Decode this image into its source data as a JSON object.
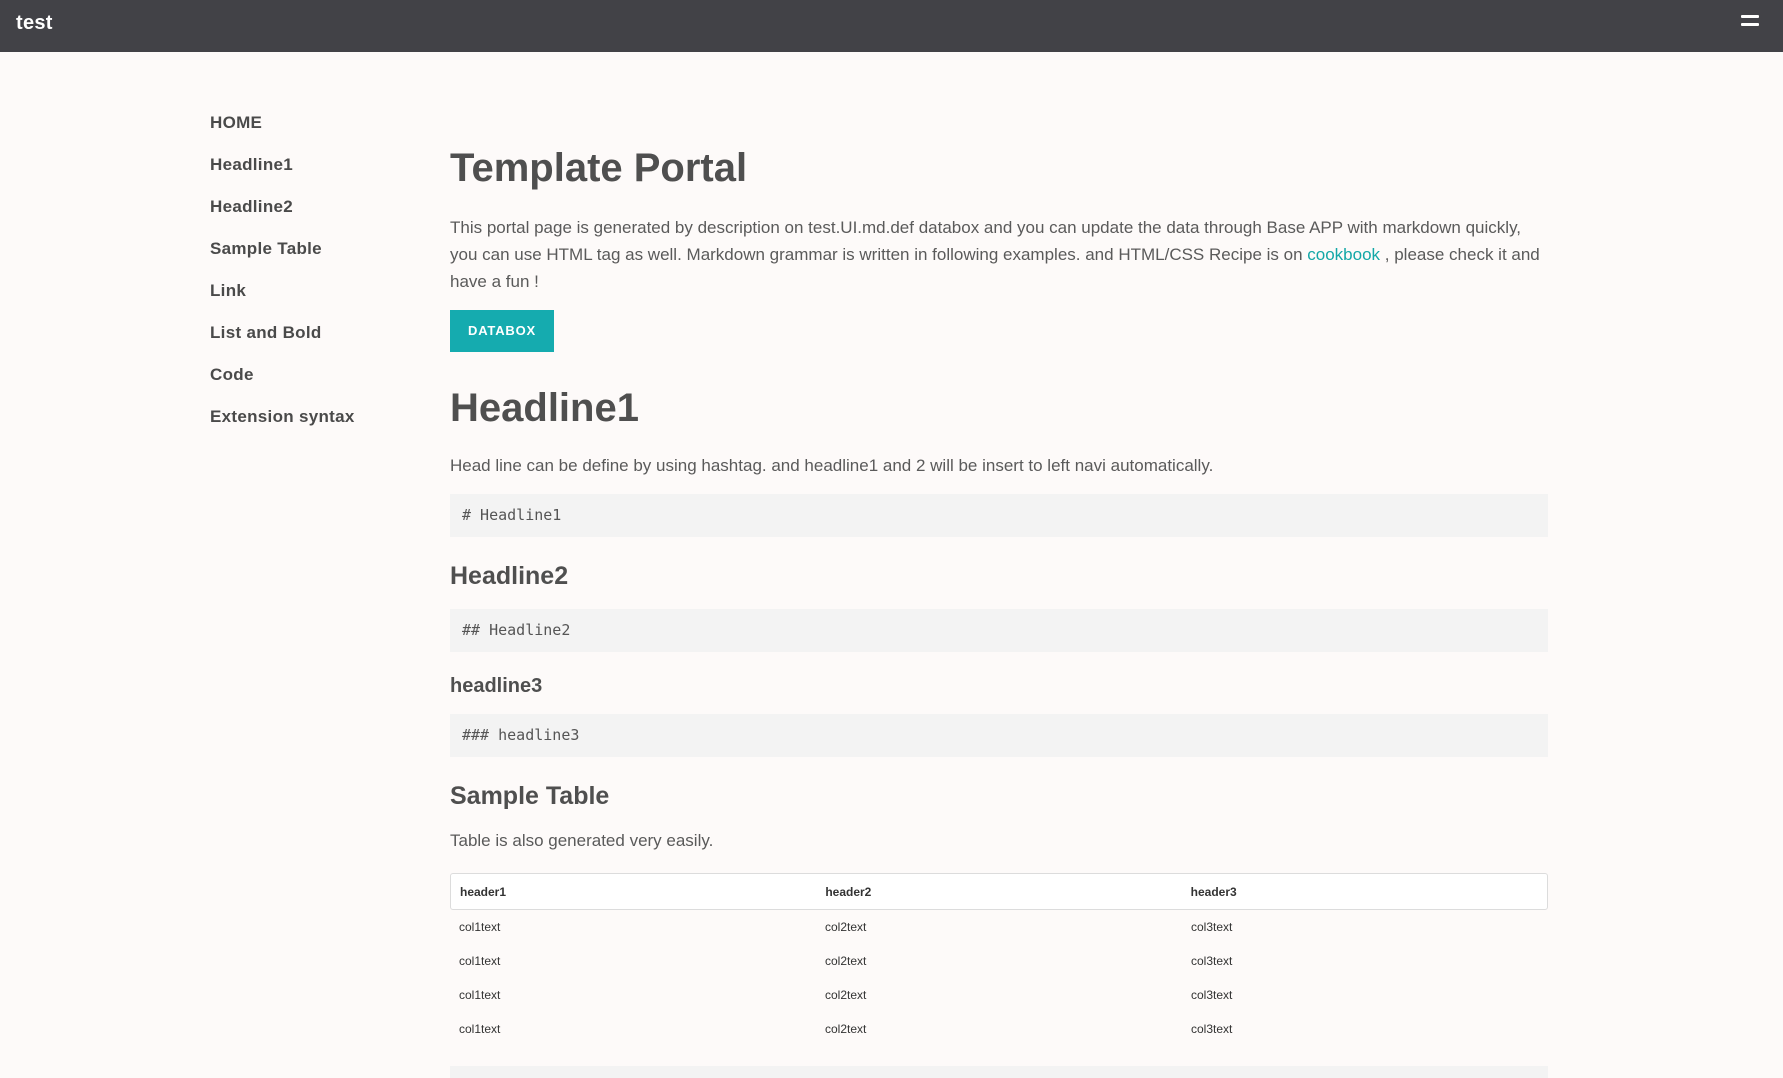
{
  "header": {
    "title": "test",
    "menu_icon": "hamburger-icon"
  },
  "sidebar": {
    "items": [
      {
        "label": "HOME"
      },
      {
        "label": "Headline1"
      },
      {
        "label": "Headline2"
      },
      {
        "label": "Sample Table"
      },
      {
        "label": "Link"
      },
      {
        "label": "List and Bold"
      },
      {
        "label": "Code"
      },
      {
        "label": "Extension syntax"
      }
    ]
  },
  "main": {
    "title": "Template Portal",
    "intro_text": "This portal page is generated by description on test.UI.md.def databox and you can update the data through Base APP with markdown quickly, you can use HTML tag as well. Markdown grammar is written in following examples. and HTML/CSS Recipe is on ",
    "intro_link": "cookbook",
    "intro_tail": " , please check it and have a fun !",
    "button_label": "DATABOX",
    "headline1": {
      "title": "Headline1",
      "desc": "Head line can be define by using hashtag. and headline1 and 2 will be insert to left navi automatically.",
      "code": "# Headline1"
    },
    "headline2": {
      "title": "Headline2",
      "code": "## Headline2"
    },
    "headline3": {
      "title": "headline3",
      "code": "### headline3"
    },
    "sample_table": {
      "title": "Sample Table",
      "desc": "Table is also generated very easily.",
      "headers": [
        "header1",
        "header2",
        "header3"
      ],
      "rows": [
        [
          "col1text",
          "col2text",
          "col3text"
        ],
        [
          "col1text",
          "col2text",
          "col3text"
        ],
        [
          "col1text",
          "col2text",
          "col3text"
        ],
        [
          "col1text",
          "col2text",
          "col3text"
        ]
      ]
    }
  },
  "colors": {
    "topbar": "#424247",
    "accent": "#15abaf",
    "link": "#13a7a7",
    "background": "#fdfaf9"
  }
}
